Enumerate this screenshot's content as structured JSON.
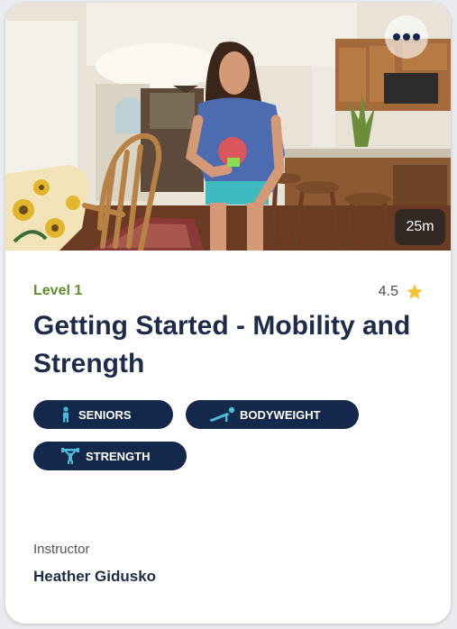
{
  "card": {
    "duration": "25m",
    "level": "Level 1",
    "rating": "4.5",
    "title": "Getting Started - Mobility and Strength",
    "tags": [
      {
        "label": "SENIORS",
        "icon": "person-icon"
      },
      {
        "label": "BODYWEIGHT",
        "icon": "pushup-icon"
      },
      {
        "label": "STRENGTH",
        "icon": "weightlifter-icon"
      }
    ],
    "instructor_label": "Instructor",
    "instructor_name": "Heather Gidusko"
  },
  "icons": {
    "more": "more-dots-icon",
    "rating": "star-icon"
  },
  "colors": {
    "level": "#5d8f2b",
    "title": "#1e2b49",
    "tag_bg": "#14284b",
    "star": "#f4c531"
  }
}
